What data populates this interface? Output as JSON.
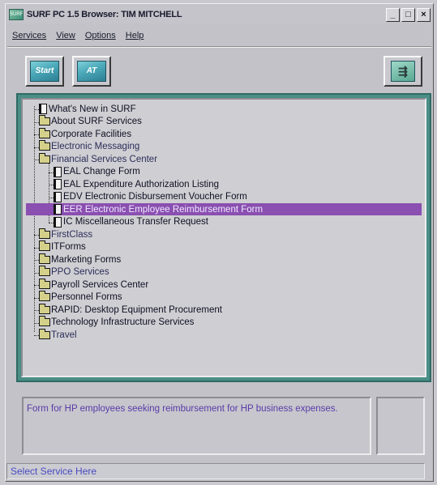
{
  "window": {
    "title": "SURF PC 1.5 Browser: TIM MITCHELL",
    "app_icon": "SURF",
    "controls": {
      "minimize": "_",
      "maximize": "□",
      "close": "×"
    }
  },
  "menu": {
    "items": [
      "Services",
      "View",
      "Options",
      "Help"
    ]
  },
  "toolbar": {
    "start_label": "Start",
    "at_label": "AT",
    "exit_icon": "exit-door-icon"
  },
  "tree": {
    "items": [
      {
        "label": "What's New in SURF",
        "type": "doc",
        "level": 0,
        "state": "normal"
      },
      {
        "label": "About SURF Services",
        "type": "folder",
        "level": 0,
        "state": "normal"
      },
      {
        "label": "Corporate Facilities",
        "type": "folder",
        "level": 0,
        "state": "normal"
      },
      {
        "label": "Electronic Messaging",
        "type": "folder",
        "level": 0,
        "state": "muted"
      },
      {
        "label": "Financial Services Center",
        "type": "folder",
        "level": 0,
        "state": "muted"
      },
      {
        "label": "EAL Change Form",
        "type": "doc",
        "level": 1,
        "state": "normal"
      },
      {
        "label": "EAL Expenditure Authorization Listing",
        "type": "doc",
        "level": 1,
        "state": "normal"
      },
      {
        "label": "EDV Electronic Disbursement Voucher Form",
        "type": "doc",
        "level": 1,
        "state": "normal"
      },
      {
        "label": "EER Electronic Employee Reimbursement Form",
        "type": "doc",
        "level": 1,
        "state": "selected"
      },
      {
        "label": "IC Miscellaneous Transfer Request",
        "type": "doc",
        "level": 1,
        "state": "normal"
      },
      {
        "label": "FirstClass",
        "type": "folder",
        "level": 0,
        "state": "muted"
      },
      {
        "label": "ITForms",
        "type": "folder",
        "level": 0,
        "state": "normal"
      },
      {
        "label": "Marketing Forms",
        "type": "folder",
        "level": 0,
        "state": "normal"
      },
      {
        "label": "PPO Services",
        "type": "folder",
        "level": 0,
        "state": "muted"
      },
      {
        "label": "Payroll Services Center",
        "type": "folder",
        "level": 0,
        "state": "normal"
      },
      {
        "label": "Personnel Forms",
        "type": "folder",
        "level": 0,
        "state": "normal"
      },
      {
        "label": "RAPID: Desktop Equipment Procurement",
        "type": "folder",
        "level": 0,
        "state": "normal"
      },
      {
        "label": "Technology Infrastructure Services",
        "type": "folder",
        "level": 0,
        "state": "normal"
      },
      {
        "label": "Travel",
        "type": "folder",
        "level": 0,
        "state": "muted"
      }
    ]
  },
  "description": {
    "text": "Form for HP employees seeking reimbursement for HP business expenses."
  },
  "status": {
    "text": "Select Service Here"
  },
  "colors": {
    "selection": "#8a4fb0",
    "frame": "#4a8e86",
    "status_text": "#4a4ac0"
  }
}
